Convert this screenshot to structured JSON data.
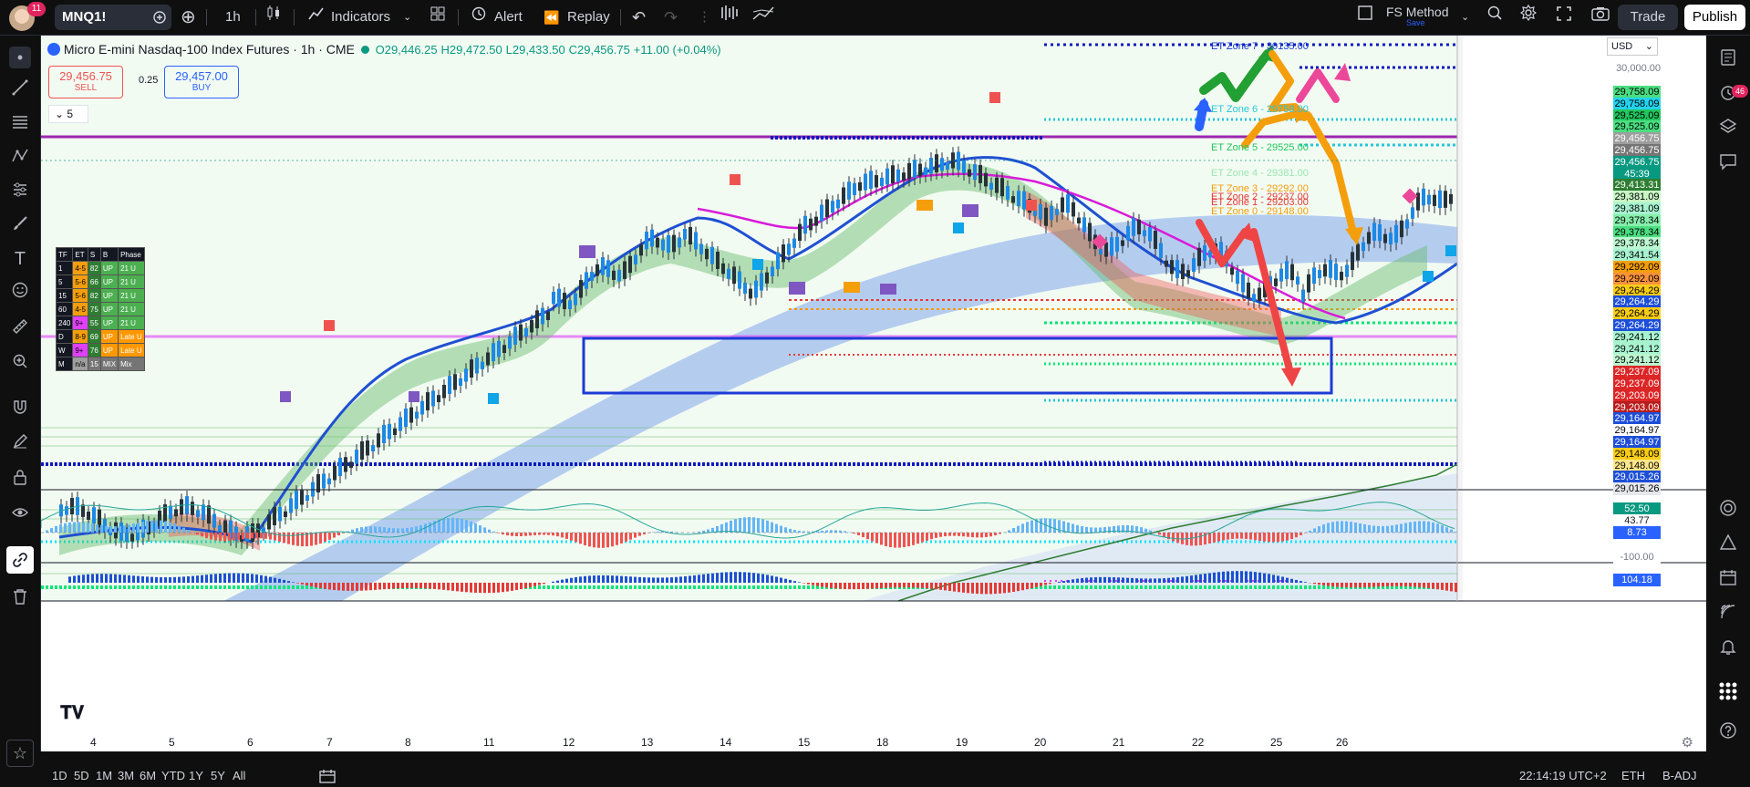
{
  "header": {
    "notif_count": "11",
    "symbol": "MNQ1!",
    "timeframe": "1h",
    "indicators_label": "Indicators",
    "alert_label": "Alert",
    "replay_label": "Replay",
    "layout_name": "FS Method",
    "layout_sub": "Save",
    "trade_label": "Trade",
    "publish_label": "Publish"
  },
  "legend": {
    "title": "Micro E-mini Nasdaq-100 Index Futures · 1h · CME",
    "open": "O29,446.25",
    "high": "H29,472.50",
    "low": "L29,433.50",
    "close": "C29,456.75",
    "change": "+11.00 (+0.04%)",
    "sell_price": "29,456.75",
    "sell_label": "SELL",
    "spread": "0.25",
    "buy_price": "29,457.00",
    "buy_label": "BUY",
    "collapse_count": "5"
  },
  "currency": "USD",
  "price_scale_top": "30,000.00",
  "zones": [
    {
      "label": "ET Zone 7 - 30135.00",
      "color": "#1d3bd6"
    },
    {
      "label": "ET Zone 6 - 29758.00",
      "color": "#26c6da"
    },
    {
      "label": "ET Zone 5 - 29525.00",
      "color": "#22c55e"
    },
    {
      "label": "ET Zone 4 - 29381.00",
      "color": "#9ae6b4"
    },
    {
      "label": "ET Zone 3 - 29292.00",
      "color": "#f59e0b"
    },
    {
      "label": "ET Zone 2 - 29237.00",
      "color": "#e53935"
    },
    {
      "label": "ET Zone 1 - 29203.00",
      "color": "#e53935"
    },
    {
      "label": "ET Zone 0 - 29148.00",
      "color": "#f59e0b"
    }
  ],
  "price_labels": [
    {
      "text": "29,758.09",
      "bg": "#4ade80",
      "fg": "#000"
    },
    {
      "text": "29,758.09",
      "bg": "#22d3ee",
      "fg": "#000"
    },
    {
      "text": "29,525.09",
      "bg": "#22c55e",
      "fg": "#000"
    },
    {
      "text": "29,525.09",
      "bg": "#4ade80",
      "fg": "#000"
    },
    {
      "text": "29,456.75",
      "bg": "#9e9e9e",
      "fg": "#fff"
    },
    {
      "text": "29,456.75",
      "bg": "#757575",
      "fg": "#fff"
    },
    {
      "text": "29,456.75",
      "bg": "#089981",
      "fg": "#fff"
    },
    {
      "text": "45:39",
      "bg": "#089981",
      "fg": "#fff"
    },
    {
      "text": "29,413.31",
      "bg": "#2e7d32",
      "fg": "#fff"
    },
    {
      "text": "29,381.09",
      "bg": "#c8f7c5",
      "fg": "#000"
    },
    {
      "text": "29,381.09",
      "bg": "#a7f3d0",
      "fg": "#000"
    },
    {
      "text": "29,378.34",
      "bg": "#86efac",
      "fg": "#000"
    },
    {
      "text": "29,378.34",
      "bg": "#4ade80",
      "fg": "#000"
    },
    {
      "text": "29,378.34",
      "bg": "#bbf7d0",
      "fg": "#000"
    },
    {
      "text": "29,341.54",
      "bg": "#a7f3d0",
      "fg": "#000"
    },
    {
      "text": "29,292.09",
      "bg": "#f59e0b",
      "fg": "#000"
    },
    {
      "text": "29,292.09",
      "bg": "#fb923c",
      "fg": "#000"
    },
    {
      "text": "29,264.29",
      "bg": "#facc15",
      "fg": "#000"
    },
    {
      "text": "29,264.29",
      "bg": "#1d4ed8",
      "fg": "#fff"
    },
    {
      "text": "29,264.29",
      "bg": "#facc15",
      "fg": "#000"
    },
    {
      "text": "29,264.29",
      "bg": "#1d4ed8",
      "fg": "#fff"
    },
    {
      "text": "29,241.12",
      "bg": "#a7f3d0",
      "fg": "#000"
    },
    {
      "text": "29,241.12",
      "bg": "#a7f3d0",
      "fg": "#000"
    },
    {
      "text": "29,241.12",
      "bg": "#bbf7d0",
      "fg": "#000"
    },
    {
      "text": "29,237.09",
      "bg": "#dc2626",
      "fg": "#fff"
    },
    {
      "text": "29,237.09",
      "bg": "#dc2626",
      "fg": "#fff"
    },
    {
      "text": "29,203.09",
      "bg": "#dc2626",
      "fg": "#fff"
    },
    {
      "text": "29,203.09",
      "bg": "#b91c1c",
      "fg": "#fff"
    },
    {
      "text": "29,164.97",
      "bg": "#1d4ed8",
      "fg": "#fff"
    },
    {
      "text": "29,164.97",
      "bg": "#ffffff",
      "fg": "#000"
    },
    {
      "text": "29,164.97",
      "bg": "#1d4ed8",
      "fg": "#fff"
    },
    {
      "text": "29,148.09",
      "bg": "#facc15",
      "fg": "#000"
    },
    {
      "text": "29,148.09",
      "bg": "#fde68a",
      "fg": "#000"
    },
    {
      "text": "29,015.26",
      "bg": "#1d4ed8",
      "fg": "#fff"
    },
    {
      "text": "29,015.26",
      "bg": "#e5e7eb",
      "fg": "#000"
    }
  ],
  "osc": {
    "v1": "52.50",
    "v2": "43.77",
    "v3": "8.73",
    "v4": "-100.00",
    "v5": "104.18"
  },
  "x_axis": [
    "4",
    "5",
    "6",
    "7",
    "8",
    "11",
    "12",
    "13",
    "14",
    "15",
    "18",
    "19",
    "20",
    "21",
    "22",
    "25",
    "26"
  ],
  "tf_table": {
    "headers": [
      "TF",
      "ET",
      "S",
      "B",
      "Phase"
    ],
    "rows": [
      [
        "1",
        "4-5",
        "82",
        "UP",
        "21 U"
      ],
      [
        "5",
        "5-6",
        "66",
        "UP",
        "21 U"
      ],
      [
        "15",
        "5-6",
        "82",
        "UP",
        "21 U"
      ],
      [
        "60",
        "4-5",
        "75",
        "UP",
        "21 U"
      ],
      [
        "240",
        "9+",
        "55",
        "UP",
        "21 U"
      ],
      [
        "D",
        "8-9",
        "69",
        "UP",
        "Late U"
      ],
      [
        "W",
        "9+",
        "76",
        "UP",
        "Late U"
      ],
      [
        "M",
        "n/a",
        "15",
        "MIX",
        "Mix"
      ]
    ]
  },
  "bottom": {
    "ranges": [
      "1D",
      "5D",
      "1M",
      "3M",
      "6M",
      "YTD",
      "1Y",
      "5Y",
      "All"
    ],
    "time": "22:14:19 UTC+2",
    "session": "ETH",
    "adj": "B-ADJ"
  },
  "right_badge": "46"
}
